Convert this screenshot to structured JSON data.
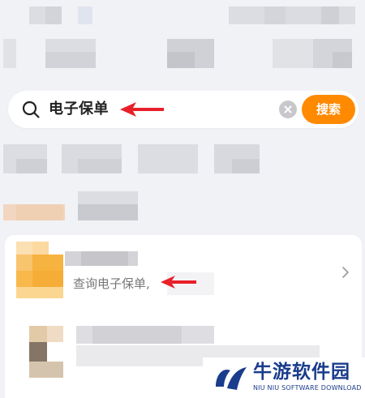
{
  "search": {
    "query": "电子保单",
    "button_label": "搜索"
  },
  "result": {
    "subtitle": "查询电子保单,"
  },
  "watermark": {
    "title": "牛游软件园",
    "subtitle": "NIU NIU SOFTWARE DOWNLOAD"
  },
  "colors": {
    "background": "#f1f2f6",
    "accent": "#ff8a00",
    "annotation_arrow": "#e8202a",
    "watermark": "#1a3c8c"
  },
  "icons": {
    "search": "search-icon",
    "clear": "clear-icon",
    "chevron": "chevron-right-icon",
    "logo": "niuniu-logo-icon"
  }
}
